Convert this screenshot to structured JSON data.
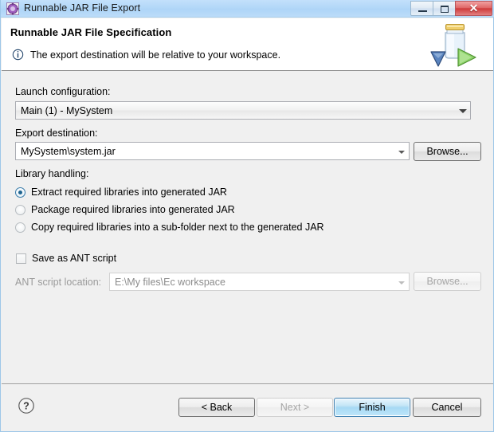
{
  "window": {
    "title": "Runnable JAR File Export",
    "icon": "jar-export-icon",
    "controls": {
      "minimize": "minimize-button",
      "maximize": "maximize-button",
      "close_glyph": "✕"
    }
  },
  "banner": {
    "title": "Runnable JAR File Specification",
    "description": "The export destination will be relative to your workspace.",
    "info_icon": "info-icon",
    "art_icon": "jar-with-arrow-icon"
  },
  "launch_configuration": {
    "label": "Launch configuration:",
    "value": "Main (1) - MySystem"
  },
  "export_destination": {
    "label": "Export destination:",
    "value": "MySystem\\system.jar",
    "browse_label": "Browse..."
  },
  "library_handling": {
    "label": "Library handling:",
    "options": [
      {
        "label": "Extract required libraries into generated JAR",
        "selected": true
      },
      {
        "label": "Package required libraries into generated JAR",
        "selected": false
      },
      {
        "label": "Copy required libraries into a sub-folder next to the generated JAR",
        "selected": false
      }
    ]
  },
  "ant_script": {
    "checkbox_label": "Save as ANT script",
    "checked": false,
    "location_label": "ANT script location:",
    "location_value": "E:\\My files\\Ec workspace",
    "browse_label": "Browse...",
    "enabled": false
  },
  "buttons": {
    "help": "help-button",
    "back": "< Back",
    "next": "Next >",
    "finish": "Finish",
    "cancel": "Cancel",
    "next_enabled": false,
    "finish_is_default": true
  },
  "colors": {
    "titlebar": "#b3d8f8",
    "close_button": "#cf3b3b",
    "default_button_border": "#3c7fb1",
    "radio_selected": "#1f6490",
    "panel": "#f0f0f0"
  }
}
